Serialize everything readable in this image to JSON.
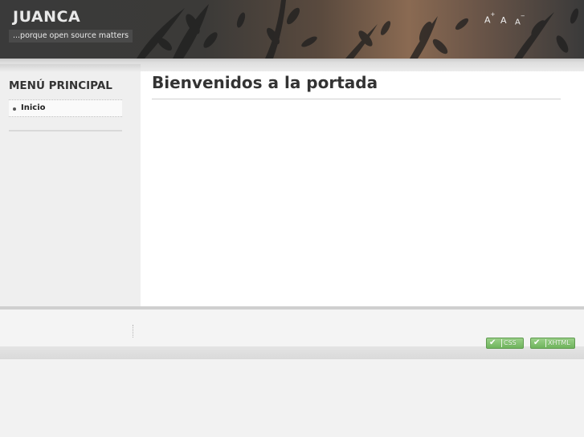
{
  "header": {
    "site_title": "JUANCA",
    "slogan": "...porque open source matters",
    "font_controls": {
      "increase": "A",
      "increase_mark": "+",
      "reset": "A",
      "decrease": "A",
      "decrease_mark": "−"
    }
  },
  "sidebar": {
    "menu_title": "MENÚ PRINCIPAL",
    "items": [
      {
        "label": "Inicio"
      }
    ]
  },
  "main": {
    "title": "Bienvenidos a la portada"
  },
  "footer": {
    "badges": [
      {
        "label": "CSS"
      },
      {
        "label": "XHTML"
      }
    ]
  },
  "colors": {
    "header_dark": "#3a3a3a",
    "header_warm": "#8a6a52",
    "badge_green": "#6fb45c",
    "page_bg": "#f2f2f2"
  }
}
